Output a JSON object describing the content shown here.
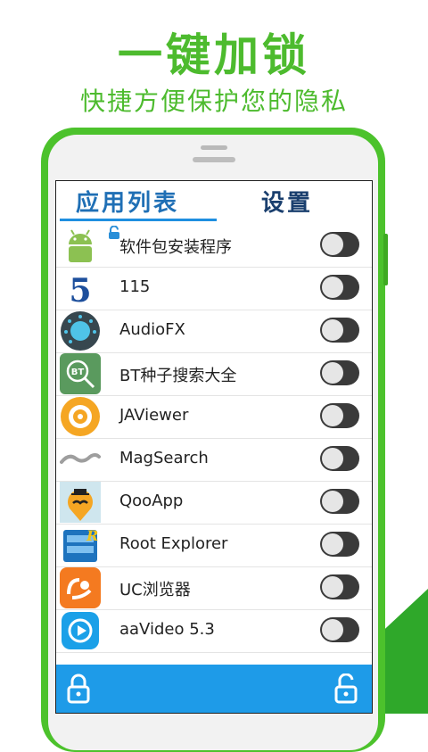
{
  "promo": {
    "headline": "一键加锁",
    "subline": "快捷方便保护您的隐私"
  },
  "tabs": {
    "apps": "应用列表",
    "settings": "设置"
  },
  "apps": [
    {
      "name": "软件包安装程序",
      "icon": "android-icon",
      "locked": false
    },
    {
      "name": "115",
      "icon": "app-115-icon",
      "locked": false
    },
    {
      "name": "AudioFX",
      "icon": "audiofx-icon",
      "locked": false
    },
    {
      "name": "BT种子搜索大全",
      "icon": "bt-search-icon",
      "locked": false
    },
    {
      "name": "JAViewer",
      "icon": "javiewer-icon",
      "locked": false
    },
    {
      "name": "MagSearch",
      "icon": "magsearch-icon",
      "locked": false
    },
    {
      "name": "QooApp",
      "icon": "qooapp-icon",
      "locked": false
    },
    {
      "name": "Root Explorer",
      "icon": "root-explorer-icon",
      "locked": false
    },
    {
      "name": "UC浏览器",
      "icon": "uc-browser-icon",
      "locked": false
    },
    {
      "name": "aaVideo 5.3",
      "icon": "aavideo-icon",
      "locked": false
    }
  ],
  "colors": {
    "brand_green": "#4dbb2e",
    "tab_blue": "#1f6fb5",
    "bottom_bar": "#1e9be8",
    "toggle_off": "#3a3a3a"
  }
}
